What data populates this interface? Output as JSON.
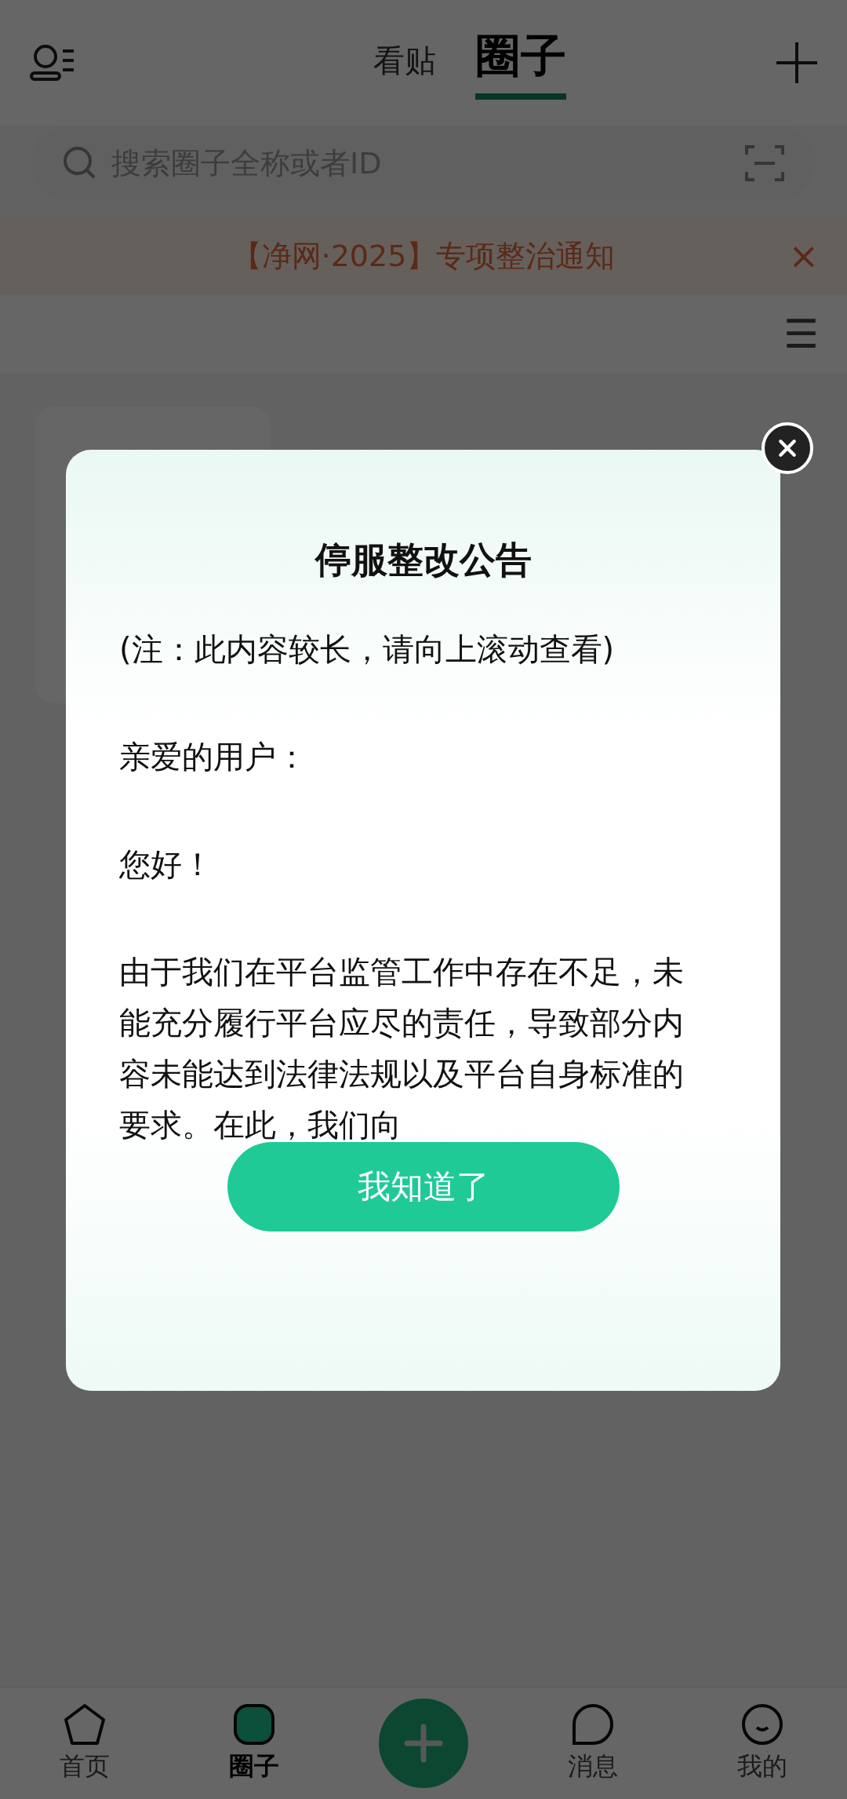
{
  "header": {
    "tabs": [
      {
        "label": "看贴",
        "selected": false
      },
      {
        "label": "圈子",
        "selected": true
      }
    ]
  },
  "search": {
    "placeholder": "搜索圈子全称或者ID"
  },
  "banner": {
    "text": "【净网·2025】专项整治通知",
    "close": "×"
  },
  "filter_menu": {
    "icon": "☰"
  },
  "dialog": {
    "title": "停服整改公告",
    "paragraphs": [
      "(注：此内容较长，请向上滚动查看)",
      "亲爱的用户：",
      "您好！",
      "由于我们在平台监管工作中存在不足，未能充分履行平台应尽的责任，导致部分内容未能达到法律法规以及平台自身标准的要求。在此，我们向"
    ],
    "button": "我知道了"
  },
  "bottom_nav": [
    {
      "label": "首页",
      "kind": "home",
      "selected": false
    },
    {
      "label": "圈子",
      "kind": "circle",
      "selected": true
    },
    {
      "label": "消息",
      "kind": "message",
      "selected": false
    },
    {
      "label": "我的",
      "kind": "profile",
      "selected": false
    }
  ]
}
